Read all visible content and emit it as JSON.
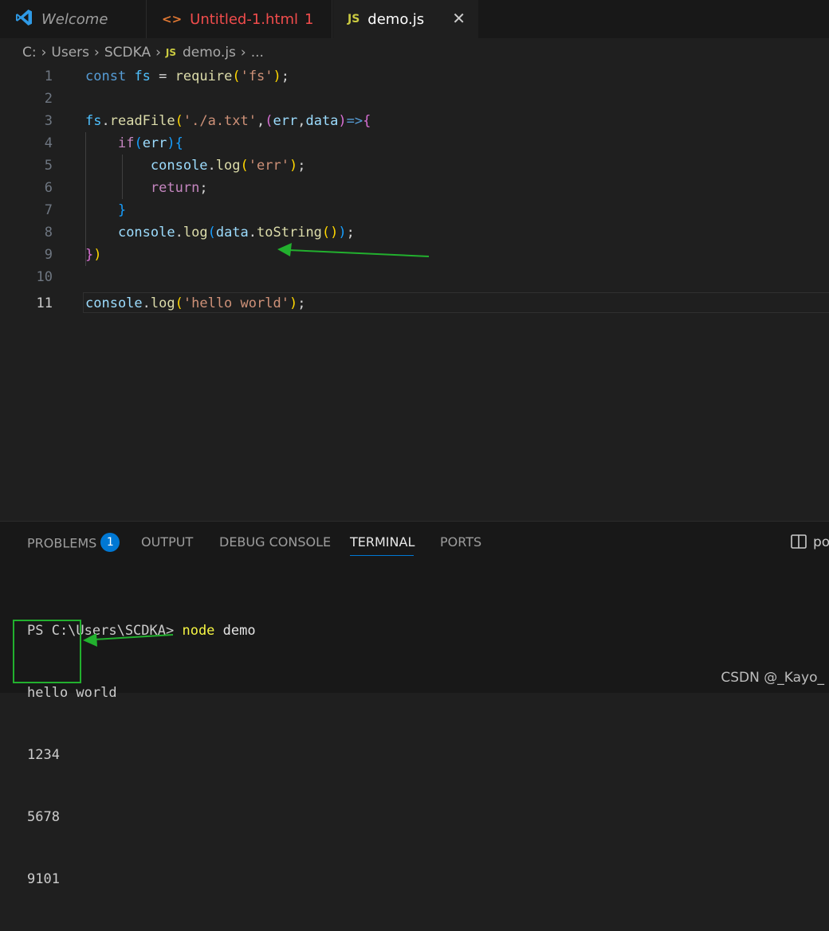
{
  "tabs": [
    {
      "label": "Welcome"
    },
    {
      "label": "Untitled-1.html",
      "problems": "1"
    },
    {
      "label": "demo.js",
      "close": "✕"
    }
  ],
  "icons": {
    "js": "JS",
    "html": "<>",
    "vscode": "vscode-logo-icon"
  },
  "breadcrumb": {
    "drive": "C:",
    "users": "Users",
    "user": "SCDKA",
    "file": "demo.js",
    "more": "..."
  },
  "editor": {
    "line_numbers": [
      "1",
      "2",
      "3",
      "4",
      "5",
      "6",
      "7",
      "8",
      "9",
      "10",
      "11"
    ],
    "active_line": "11"
  },
  "panel": {
    "tabs": [
      "PROBLEMS",
      "OUTPUT",
      "DEBUG CONSOLE",
      "TERMINAL",
      "PORTS"
    ],
    "problems_count": "1",
    "active_tab": "TERMINAL",
    "right_label": "po"
  },
  "terminal": {
    "prompt": "PS C:\\Users\\SCDKA> ",
    "command": "node",
    "arg": " demo",
    "lines": [
      "hello world",
      "1234",
      "5678",
      "9101"
    ]
  },
  "watermark": "CSDN @_Kayo_",
  "colors": {
    "accent": "#0078d4",
    "annotation": "#22b02e"
  }
}
